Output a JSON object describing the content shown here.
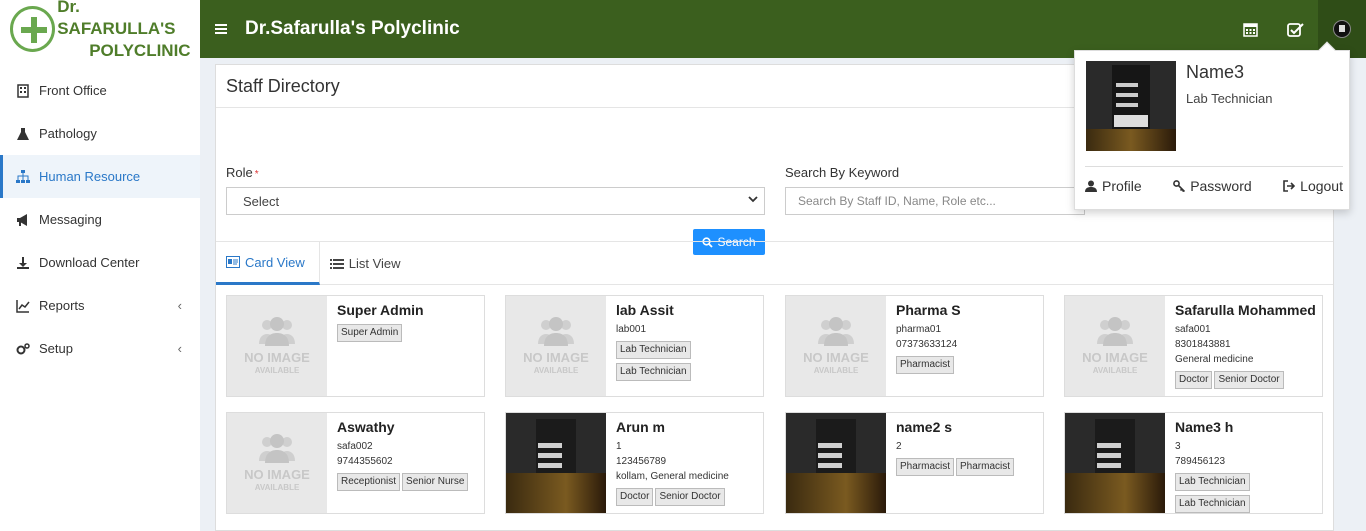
{
  "brand": {
    "line1": "Dr. SAFARULLA'S",
    "line2": "POLYCLINIC",
    "color": "#4f7d2a"
  },
  "header": {
    "title": "Dr.Safarulla's Polyclinic",
    "bg_color": "#3b5f1e"
  },
  "sidebar": {
    "items": [
      {
        "label": "Front Office",
        "icon": "building-icon"
      },
      {
        "label": "Pathology",
        "icon": "flask-icon"
      },
      {
        "label": "Human Resource",
        "icon": "sitemap-icon",
        "active": true
      },
      {
        "label": "Messaging",
        "icon": "bullhorn-icon"
      },
      {
        "label": "Download Center",
        "icon": "download-icon"
      },
      {
        "label": "Reports",
        "icon": "line-chart-icon",
        "chevron": "‹"
      },
      {
        "label": "Setup",
        "icon": "cogs-icon",
        "chevron": "‹"
      }
    ]
  },
  "page": {
    "title": "Staff Directory",
    "role_label": "Role",
    "role_required": "*",
    "role_value": "Select",
    "keyword_label": "Search By Keyword",
    "keyword_placeholder": "Search By Staff ID, Name, Role etc...",
    "search_button": "Search",
    "tabs": [
      {
        "label": "Card View",
        "active": true
      },
      {
        "label": "List View"
      }
    ]
  },
  "noimage": {
    "line1": "NO IMAGE",
    "line2": "AVAILABLE"
  },
  "staff": [
    {
      "name": "Super Admin",
      "lines": [],
      "badges": [
        "Super Admin"
      ],
      "photo": false
    },
    {
      "name": "lab Assit",
      "lines": [
        "lab001"
      ],
      "badges": [
        "Lab Technician",
        "Lab Technician"
      ],
      "photo": false
    },
    {
      "name": "Pharma S",
      "lines": [
        "pharma01",
        "07373633124"
      ],
      "badges": [
        "Pharmacist"
      ],
      "photo": false
    },
    {
      "name": "Safarulla Mohammed",
      "lines": [
        "safa001",
        "8301843881",
        "General medicine"
      ],
      "badges": [
        "Doctor",
        "Senior Doctor"
      ],
      "photo": false
    },
    {
      "name": "Aswathy",
      "lines": [
        "safa002",
        "9744355602"
      ],
      "badges": [
        "Receptionist",
        "Senior Nurse"
      ],
      "photo": false
    },
    {
      "name": "Arun m",
      "lines": [
        "1",
        "123456789",
        "kollam, General medicine"
      ],
      "badges": [
        "Doctor",
        "Senior Doctor"
      ],
      "photo": true
    },
    {
      "name": "name2 s",
      "lines": [
        "2"
      ],
      "badges": [
        "Pharmacist",
        "Pharmacist"
      ],
      "photo": true
    },
    {
      "name": "Name3 h",
      "lines": [
        "3",
        "789456123"
      ],
      "badges": [
        "Lab Technician",
        "Lab Technician"
      ],
      "photo": true
    }
  ],
  "user_menu": {
    "name": "Name3",
    "role": "Lab Technician",
    "profile": "Profile",
    "password": "Password",
    "logout": "Logout"
  }
}
